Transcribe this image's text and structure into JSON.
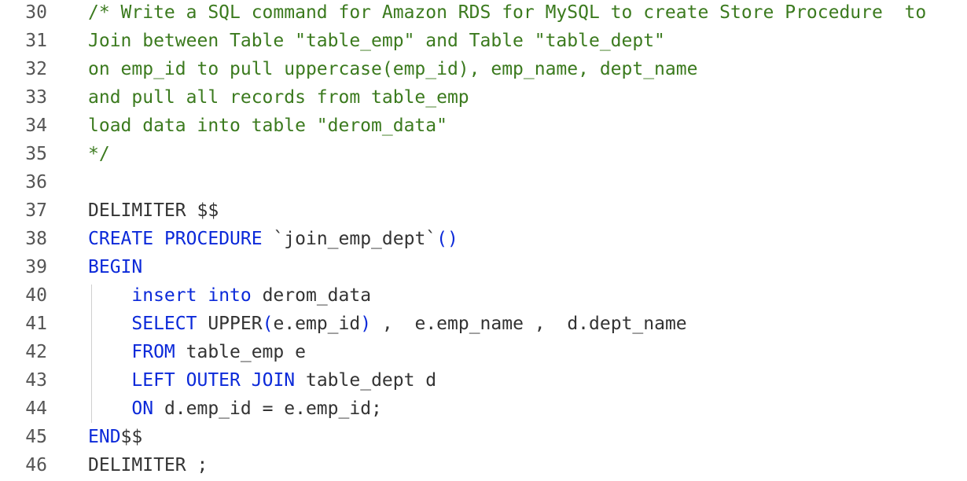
{
  "editor": {
    "lines": [
      {
        "num": "30",
        "tokens": [
          {
            "t": "/* Write a SQL command for Amazon RDS for MySQL to create Store Procedure  to",
            "c": "comment"
          }
        ]
      },
      {
        "num": "31",
        "tokens": [
          {
            "t": "Join between Table \"table_emp\" and Table \"table_dept\"",
            "c": "comment"
          }
        ]
      },
      {
        "num": "32",
        "tokens": [
          {
            "t": "on emp_id to pull uppercase(emp_id), emp_name, dept_name",
            "c": "comment"
          }
        ]
      },
      {
        "num": "33",
        "tokens": [
          {
            "t": "and pull all records from table_emp",
            "c": "comment"
          }
        ]
      },
      {
        "num": "34",
        "tokens": [
          {
            "t": "load data into table \"derom_data\"",
            "c": "comment"
          }
        ]
      },
      {
        "num": "35",
        "tokens": [
          {
            "t": "*/",
            "c": "comment"
          }
        ]
      },
      {
        "num": "36",
        "tokens": []
      },
      {
        "num": "37",
        "tokens": [
          {
            "t": "DELIMITER $$",
            "c": "plain"
          }
        ]
      },
      {
        "num": "38",
        "tokens": [
          {
            "t": "CREATE",
            "c": "kw"
          },
          {
            "t": " ",
            "c": "plain"
          },
          {
            "t": "PROCEDURE",
            "c": "kw"
          },
          {
            "t": " `join_emp_dept`",
            "c": "str"
          },
          {
            "t": "()",
            "c": "kw"
          }
        ]
      },
      {
        "num": "39",
        "tokens": [
          {
            "t": "BEGIN",
            "c": "kw"
          }
        ]
      },
      {
        "num": "40",
        "tokens": [
          {
            "t": "    ",
            "c": "plain"
          },
          {
            "t": "insert",
            "c": "kw"
          },
          {
            "t": " ",
            "c": "plain"
          },
          {
            "t": "into",
            "c": "kw"
          },
          {
            "t": " derom_data",
            "c": "plain"
          }
        ]
      },
      {
        "num": "41",
        "tokens": [
          {
            "t": "    ",
            "c": "plain"
          },
          {
            "t": "SELECT",
            "c": "kw"
          },
          {
            "t": " UPPER",
            "c": "plain"
          },
          {
            "t": "(",
            "c": "kw"
          },
          {
            "t": "e.emp_id",
            "c": "plain"
          },
          {
            "t": ")",
            "c": "kw"
          },
          {
            "t": " ,  e.emp_name ,  d.dept_name",
            "c": "plain"
          }
        ]
      },
      {
        "num": "42",
        "tokens": [
          {
            "t": "    ",
            "c": "plain"
          },
          {
            "t": "FROM",
            "c": "kw"
          },
          {
            "t": " table_emp e",
            "c": "plain"
          }
        ]
      },
      {
        "num": "43",
        "tokens": [
          {
            "t": "    ",
            "c": "plain"
          },
          {
            "t": "LEFT",
            "c": "kw"
          },
          {
            "t": " ",
            "c": "plain"
          },
          {
            "t": "OUTER",
            "c": "kw"
          },
          {
            "t": " ",
            "c": "plain"
          },
          {
            "t": "JOIN",
            "c": "kw"
          },
          {
            "t": " table_dept d",
            "c": "plain"
          }
        ]
      },
      {
        "num": "44",
        "tokens": [
          {
            "t": "    ",
            "c": "plain"
          },
          {
            "t": "ON",
            "c": "kw"
          },
          {
            "t": " d.emp_id = e.emp_id;",
            "c": "plain"
          }
        ]
      },
      {
        "num": "45",
        "tokens": [
          {
            "t": "END",
            "c": "kw"
          },
          {
            "t": "$$",
            "c": "plain"
          }
        ]
      },
      {
        "num": "46",
        "tokens": [
          {
            "t": "DELIMITER ;",
            "c": "plain"
          }
        ]
      }
    ]
  },
  "colors": {
    "comment": "#3b7a1e",
    "keyword": "#0b29d9",
    "plain": "#333333",
    "line_number": "#555555",
    "background": "#ffffff"
  }
}
